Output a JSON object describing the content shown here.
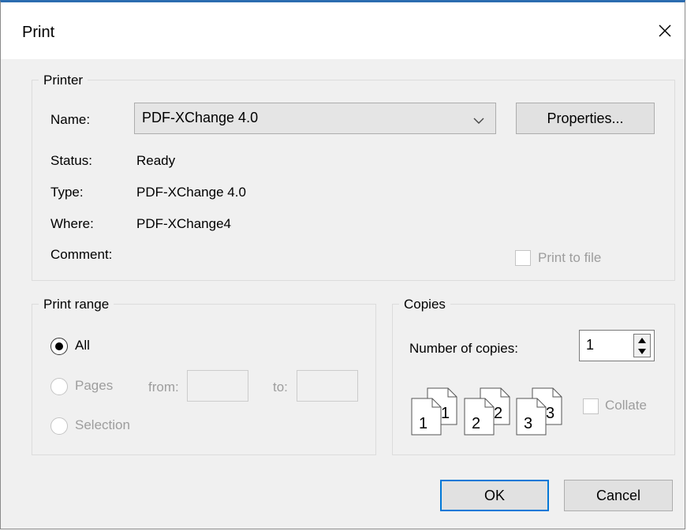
{
  "window": {
    "title": "Print"
  },
  "printer": {
    "legend": "Printer",
    "name_label": "Name:",
    "name_value": "PDF-XChange 4.0",
    "properties_button": "Properties...",
    "status_label": "Status:",
    "status_value": "Ready",
    "type_label": "Type:",
    "type_value": "PDF-XChange 4.0",
    "where_label": "Where:",
    "where_value": "PDF-XChange4",
    "comment_label": "Comment:",
    "print_to_file_label": "Print to file"
  },
  "print_range": {
    "legend": "Print range",
    "all_label": "All",
    "pages_label": "Pages",
    "from_label": "from:",
    "to_label": "to:",
    "selection_label": "Selection",
    "selected": "All"
  },
  "copies": {
    "legend": "Copies",
    "number_label": "Number of copies:",
    "number_value": "1",
    "collate_label": "Collate",
    "page_numbers": [
      "1",
      "1",
      "2",
      "2",
      "3",
      "3"
    ]
  },
  "buttons": {
    "ok": "OK",
    "cancel": "Cancel"
  },
  "colors": {
    "accent": "#0078d7",
    "disabled_text": "#9d9d9d"
  }
}
